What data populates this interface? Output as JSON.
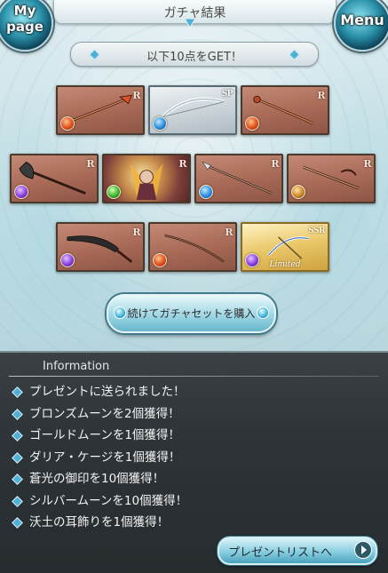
{
  "header": {
    "title": "ガチャ結果"
  },
  "nav": {
    "mypage_label": "My page",
    "mypage_line1": "My",
    "mypage_line2": "page",
    "menu_label": "Menu"
  },
  "result": {
    "banner": "以下10点をGET！"
  },
  "items": [
    {
      "rarity": "R",
      "element": "fire",
      "kind": "weapon"
    },
    {
      "rarity": "SP",
      "element": "water",
      "kind": "weapon"
    },
    {
      "rarity": "R",
      "element": "fire",
      "kind": "weapon"
    },
    {
      "rarity": "R",
      "element": "dark",
      "kind": "weapon"
    },
    {
      "rarity": "R",
      "element": "wind",
      "kind": "summon"
    },
    {
      "rarity": "R",
      "element": "water",
      "kind": "weapon"
    },
    {
      "rarity": "R",
      "element": "earth",
      "kind": "weapon"
    },
    {
      "rarity": "R",
      "element": "dark",
      "kind": "weapon"
    },
    {
      "rarity": "R",
      "element": "fire",
      "kind": "weapon"
    },
    {
      "rarity": "SSR",
      "element": "dark",
      "kind": "weapon",
      "tag": "Limited"
    }
  ],
  "buy_button": {
    "label": "続けてガチャセットを購入"
  },
  "info": {
    "title": "Information",
    "messages": [
      "プレゼントに送られました！",
      "ブロンズムーンを2個獲得！",
      "ゴールドムーンを1個獲得！",
      "ダリア・ケージを1個獲得！",
      "蒼光の御印を10個獲得！",
      "シルバームーンを10個獲得！",
      "沃土の耳飾りを1個獲得！"
    ]
  },
  "present_button": {
    "label": "プレゼントリストへ"
  }
}
